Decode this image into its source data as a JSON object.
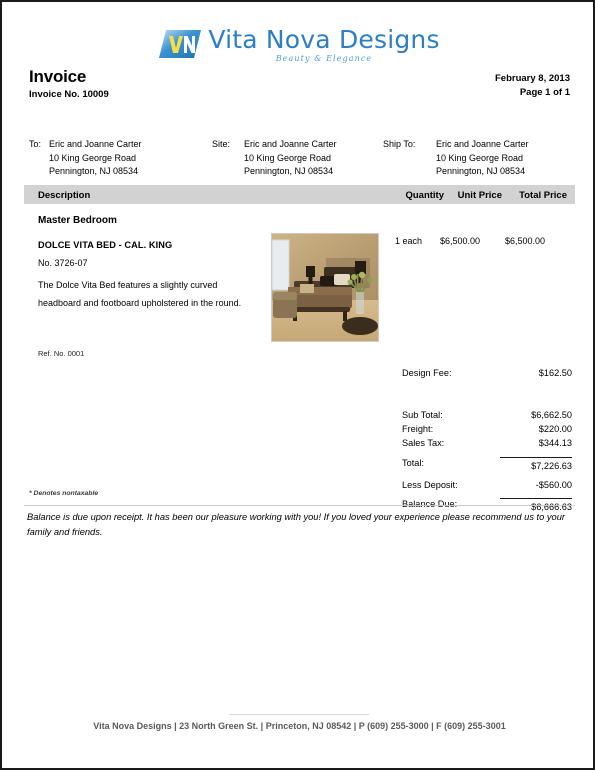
{
  "brand": {
    "name": "Vita Nova Designs",
    "tagline": "Beauty & Elegance",
    "logo_initials": "VN",
    "logo_blue": "#2c7fc4",
    "logo_yellow": "#f3e04a"
  },
  "header": {
    "title": "Invoice",
    "invoice_no": "Invoice No. 10009",
    "date": "February 8, 2013",
    "page": "Page 1 of 1"
  },
  "addresses": {
    "to": {
      "label": "To:",
      "lines": [
        "Eric and Joanne Carter",
        "10 King George Road",
        "Pennington, NJ  08534"
      ]
    },
    "site": {
      "label": "Site:",
      "lines": [
        "Eric and Joanne Carter",
        "10 King George Road",
        "Pennington, NJ  08534"
      ]
    },
    "ship_to": {
      "label": "Ship To:",
      "lines": [
        "Eric and Joanne Carter",
        "10 King George Road",
        "Pennington, NJ  08534"
      ]
    }
  },
  "table": {
    "columns": {
      "description": "Description",
      "quantity": "Quantity",
      "unit_price": "Unit Price",
      "total_price": "Total Price"
    },
    "header_bg": "#d2d2d2",
    "room": "Master Bedroom",
    "item": {
      "name": "DOLCE VITA BED - CAL. KING",
      "sku": "No. 3726-07",
      "description": "The Dolce Vita Bed features a slightly curved headboard and footboard upholstered in the round.",
      "ref": "Ref. No. 0001",
      "quantity": "1 each",
      "unit_price": "$6,500.00",
      "total_price": "$6,500.00",
      "image_alt": "master-bedroom-photo"
    }
  },
  "totals": {
    "design_fee": {
      "label": "Design Fee:",
      "value": "$162.50"
    },
    "rows": [
      {
        "label": "Sub Total:",
        "value": "$6,662.50"
      },
      {
        "label": "Freight:",
        "value": "$220.00"
      },
      {
        "label": "Sales Tax:",
        "value": "$344.13"
      },
      {
        "label": "Total:",
        "value": "$7,226.63"
      },
      {
        "label": "Less Deposit:",
        "value": "-$560.00"
      },
      {
        "label": "Balance Due:",
        "value": "$6,666.63"
      }
    ]
  },
  "notes": {
    "nontaxable": "* Denotes nontaxable",
    "message": "Balance is due upon receipt.  It has been our pleasure working with you!  If you loved your experience please recommend us to your family and friends."
  },
  "footer": {
    "text": "Vita Nova Designs | 23 North Green St. | Princeton, NJ  08542 | P (609) 255-3000 | F (609) 255-3001"
  }
}
